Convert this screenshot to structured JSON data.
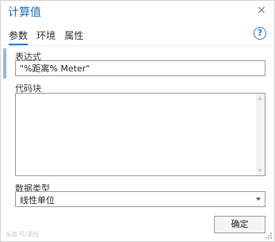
{
  "window": {
    "title": "计算值",
    "close_glyph": "×"
  },
  "tabs": [
    {
      "label": "参数",
      "active": true
    },
    {
      "label": "环境",
      "active": false
    },
    {
      "label": "属性",
      "active": false
    }
  ],
  "help": {
    "glyph": "?"
  },
  "expression": {
    "label": "表达式",
    "value": "\"%距离% Meter\""
  },
  "code_block": {
    "label": "代码块",
    "value": ""
  },
  "data_type": {
    "label": "数据类型",
    "selected": "线性单位"
  },
  "ok_button": {
    "label": "确定"
  },
  "watermark": {
    "text": "头条号/测绘"
  },
  "colors": {
    "title": "#1b6fb0",
    "accent": "#2b7ac4",
    "accent_bar": "#9fb5cf"
  }
}
